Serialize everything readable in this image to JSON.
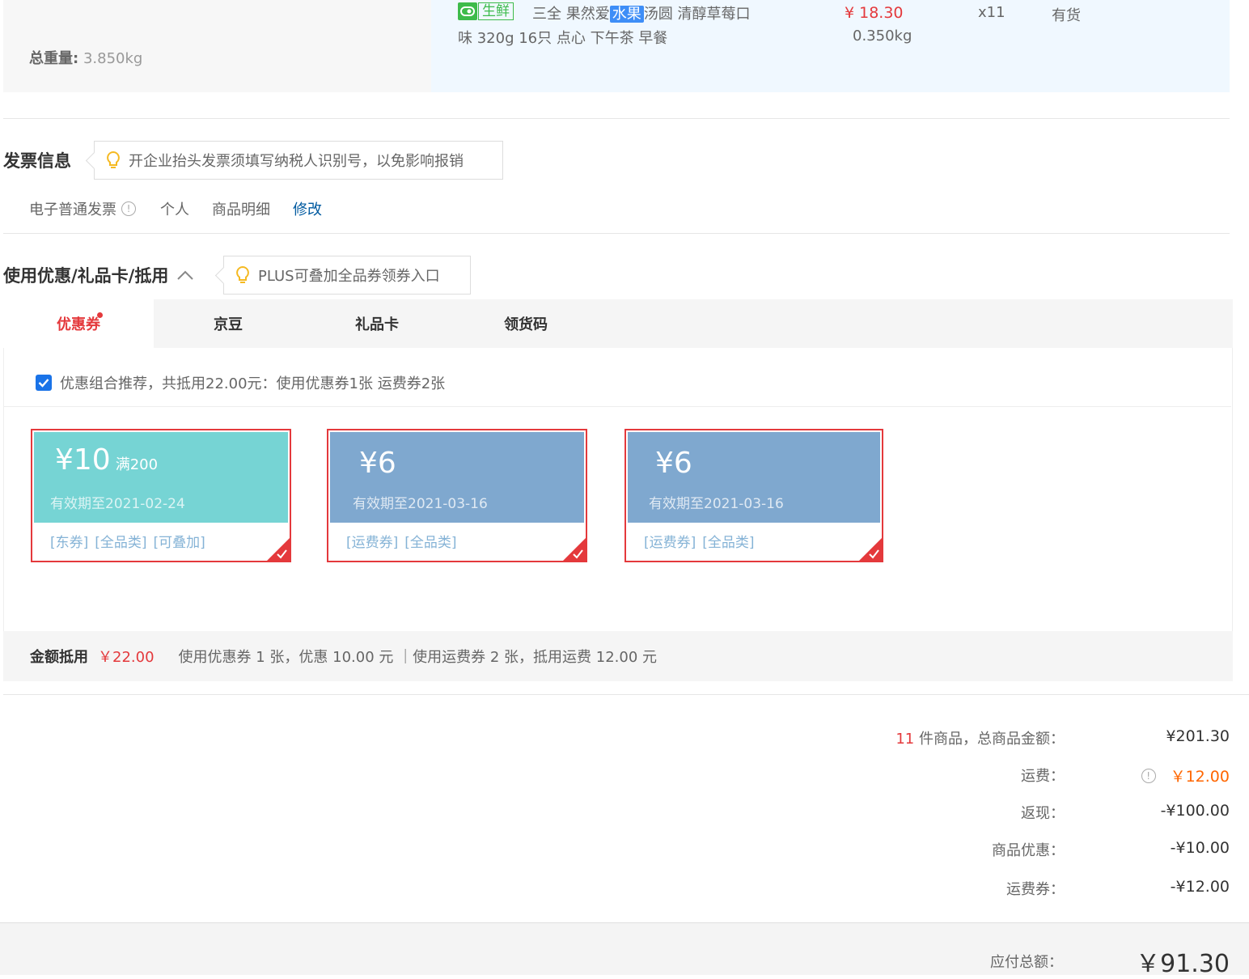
{
  "shipping": {
    "weight_label": "总重量:",
    "weight_value": "3.850kg"
  },
  "product": {
    "tag_text": "生鲜",
    "tag_icon": "fresh-icon",
    "name_pre": "三全 果然爱",
    "name_highlight": "水果",
    "name_post": "汤圆 清醇草莓口",
    "name_line2": "味 320g 16只 点心 下午茶 早餐",
    "price": "¥ 18.30",
    "weight": "0.350kg",
    "quantity": "x11",
    "stock": "有货"
  },
  "invoice": {
    "title": "发票信息",
    "tip": "开企业抬头发票须填写纳税人识别号，以免影响报销",
    "type": "电子普通发票",
    "holder": "个人",
    "content": "商品明细",
    "edit_link": "修改"
  },
  "discount": {
    "title": "使用优惠/礼品卡/抵用",
    "tip": "PLUS可叠加全品券领券入口",
    "tabs": [
      {
        "label": "优惠券"
      },
      {
        "label": "京豆"
      },
      {
        "label": "礼品卡"
      },
      {
        "label": "领货码"
      }
    ],
    "combo_text": "优惠组合推荐，共抵用22.00元：使用优惠券1张 运费券2张",
    "combo_checked": true,
    "coupons": [
      {
        "amount": "¥10",
        "condition": "满200",
        "expiry": "有效期至2021-02-24",
        "tags": [
          "[东券]",
          "[全品类]",
          "[可叠加]"
        ],
        "color": "#76d4d4"
      },
      {
        "amount": "¥6",
        "condition": "",
        "expiry": "有效期至2021-03-16",
        "tags": [
          "[运费券]",
          "[全品类]"
        ],
        "color": "#7fa8cf"
      },
      {
        "amount": "¥6",
        "condition": "",
        "expiry": "有效期至2021-03-16",
        "tags": [
          "[运费券]",
          "[全品类]"
        ],
        "color": "#7fa8cf"
      }
    ],
    "summary_label": "金额抵用",
    "summary_amount": "￥22.00",
    "summary_detail": "使用优惠券 1 张，优惠 10.00 元 ｜使用运费券 2 张，抵用运费 12.00 元"
  },
  "totals": {
    "item_count": "11",
    "goods_label": " 件商品，总商品金额：",
    "goods_value": "¥201.30",
    "freight_label": "运费：",
    "freight_value": "￥12.00",
    "cashback_label": "返现：",
    "cashback_value": "-¥100.00",
    "discount_label": "商品优惠：",
    "discount_value": "-¥10.00",
    "freight_coupon_label": "运费券：",
    "freight_coupon_value": "-¥12.00",
    "payable_label": "应付总额：",
    "payable_value": "￥91.30"
  },
  "colors": {
    "accent_red": "#e4393c",
    "link_blue": "#005aa0",
    "fresh_green": "#3dbb4b",
    "freight_orange": "#ff6600"
  }
}
